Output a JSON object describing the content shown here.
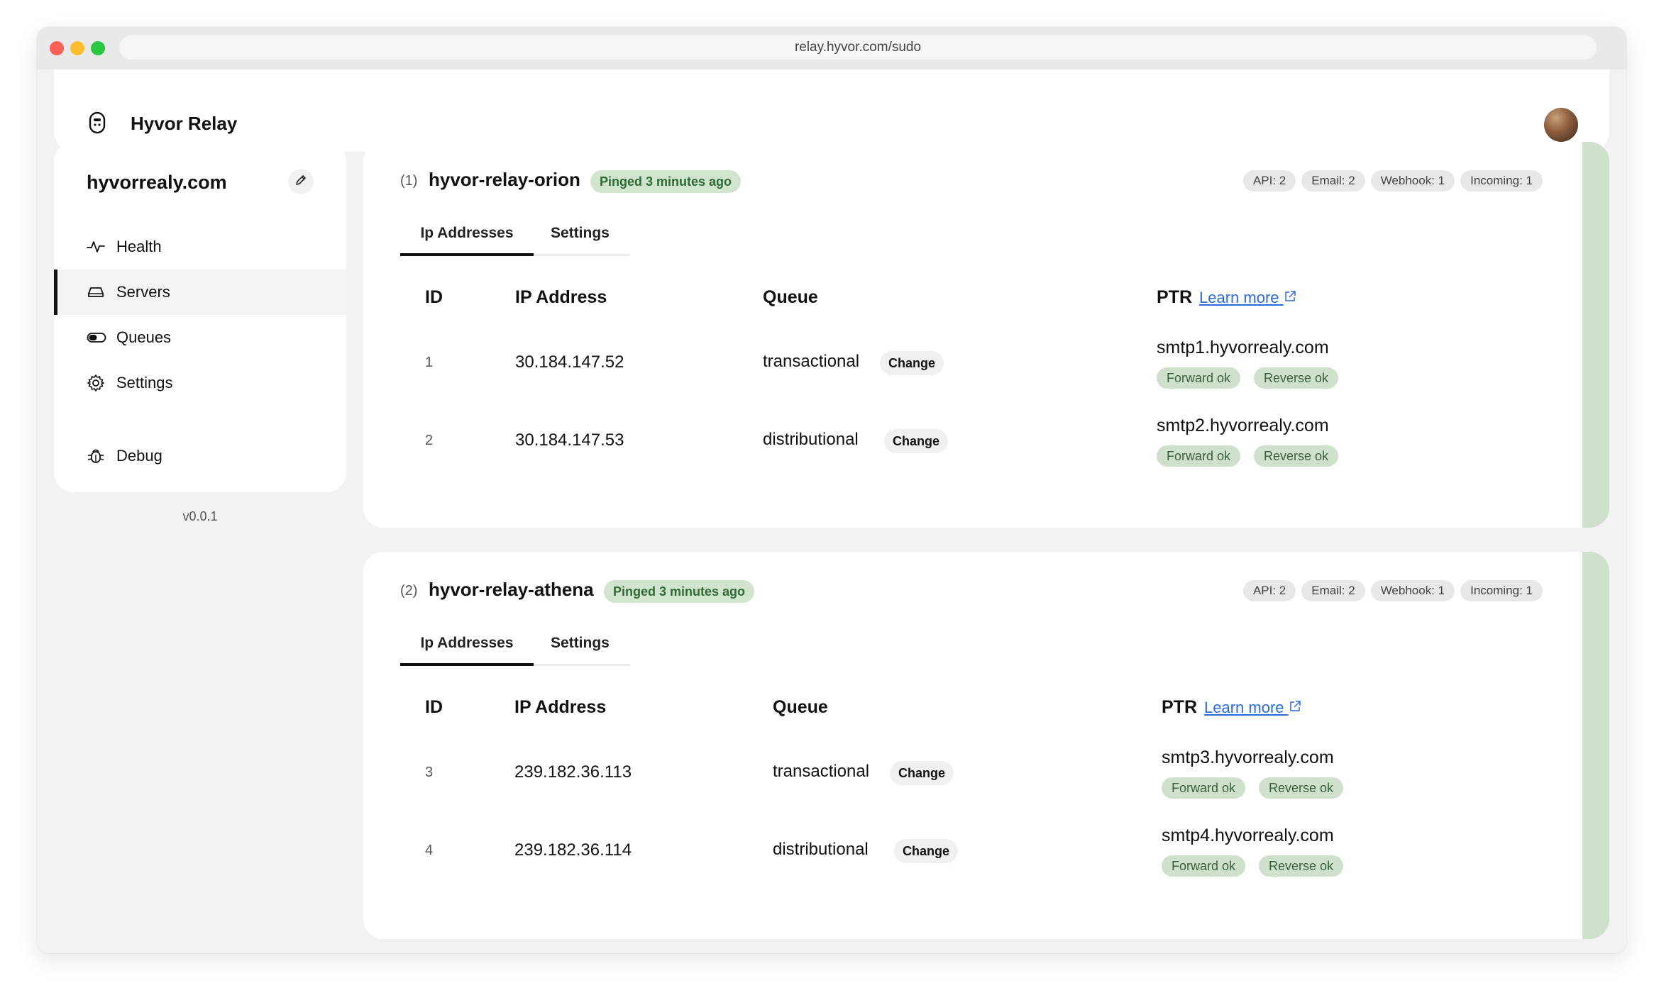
{
  "browser": {
    "url": "relay.hyvor.com/sudo"
  },
  "app": {
    "brand": "Hyvor Relay"
  },
  "sidebar": {
    "title": "hyvorrealy.com",
    "items": [
      {
        "label": "Health",
        "icon": "pulse-icon"
      },
      {
        "label": "Servers",
        "icon": "server-icon",
        "active": true
      },
      {
        "label": "Queues",
        "icon": "toggle-icon"
      },
      {
        "label": "Settings",
        "icon": "gear-icon"
      },
      {
        "label": "Debug",
        "icon": "bug-icon"
      }
    ],
    "version": "v0.0.1"
  },
  "servers": [
    {
      "index": "(1)",
      "name": "hyvor-relay-orion",
      "status": "Pinged 3 minutes ago",
      "stats": [
        "API: 2",
        "Email: 2",
        "Webhook: 1",
        "Incoming: 1"
      ],
      "tabs": [
        "Ip Addresses",
        "Settings"
      ],
      "headers": {
        "id": "ID",
        "ip": "IP Address",
        "queue": "Queue",
        "ptr": "PTR",
        "learn_more": "Learn more"
      },
      "rows": [
        {
          "id": "1",
          "ip": "30.184.147.52",
          "queue": "transactional",
          "change": "Change",
          "ptr": "smtp1.hyvorrealy.com",
          "forward": "Forward ok",
          "reverse": "Reverse ok"
        },
        {
          "id": "2",
          "ip": "30.184.147.53",
          "queue": "distributional",
          "change": "Change",
          "ptr": "smtp2.hyvorrealy.com",
          "forward": "Forward ok",
          "reverse": "Reverse ok"
        }
      ]
    },
    {
      "index": "(2)",
      "name": "hyvor-relay-athena",
      "status": "Pinged 3 minutes ago",
      "stats": [
        "API: 2",
        "Email: 2",
        "Webhook: 1",
        "Incoming: 1"
      ],
      "tabs": [
        "Ip Addresses",
        "Settings"
      ],
      "headers": {
        "id": "ID",
        "ip": "IP Address",
        "queue": "Queue",
        "ptr": "PTR",
        "learn_more": "Learn more"
      },
      "rows": [
        {
          "id": "3",
          "ip": "239.182.36.113",
          "queue": "transactional",
          "change": "Change",
          "ptr": "smtp3.hyvorrealy.com",
          "forward": "Forward ok",
          "reverse": "Reverse ok"
        },
        {
          "id": "4",
          "ip": "239.182.36.114",
          "queue": "distributional",
          "change": "Change",
          "ptr": "smtp4.hyvorrealy.com",
          "forward": "Forward ok",
          "reverse": "Reverse ok"
        }
      ]
    }
  ],
  "colors": {
    "accent": "#cfe0cc",
    "ping_bg": "#d1e4cd",
    "ping_text": "#2f6b36",
    "link": "#2c6bdb"
  }
}
